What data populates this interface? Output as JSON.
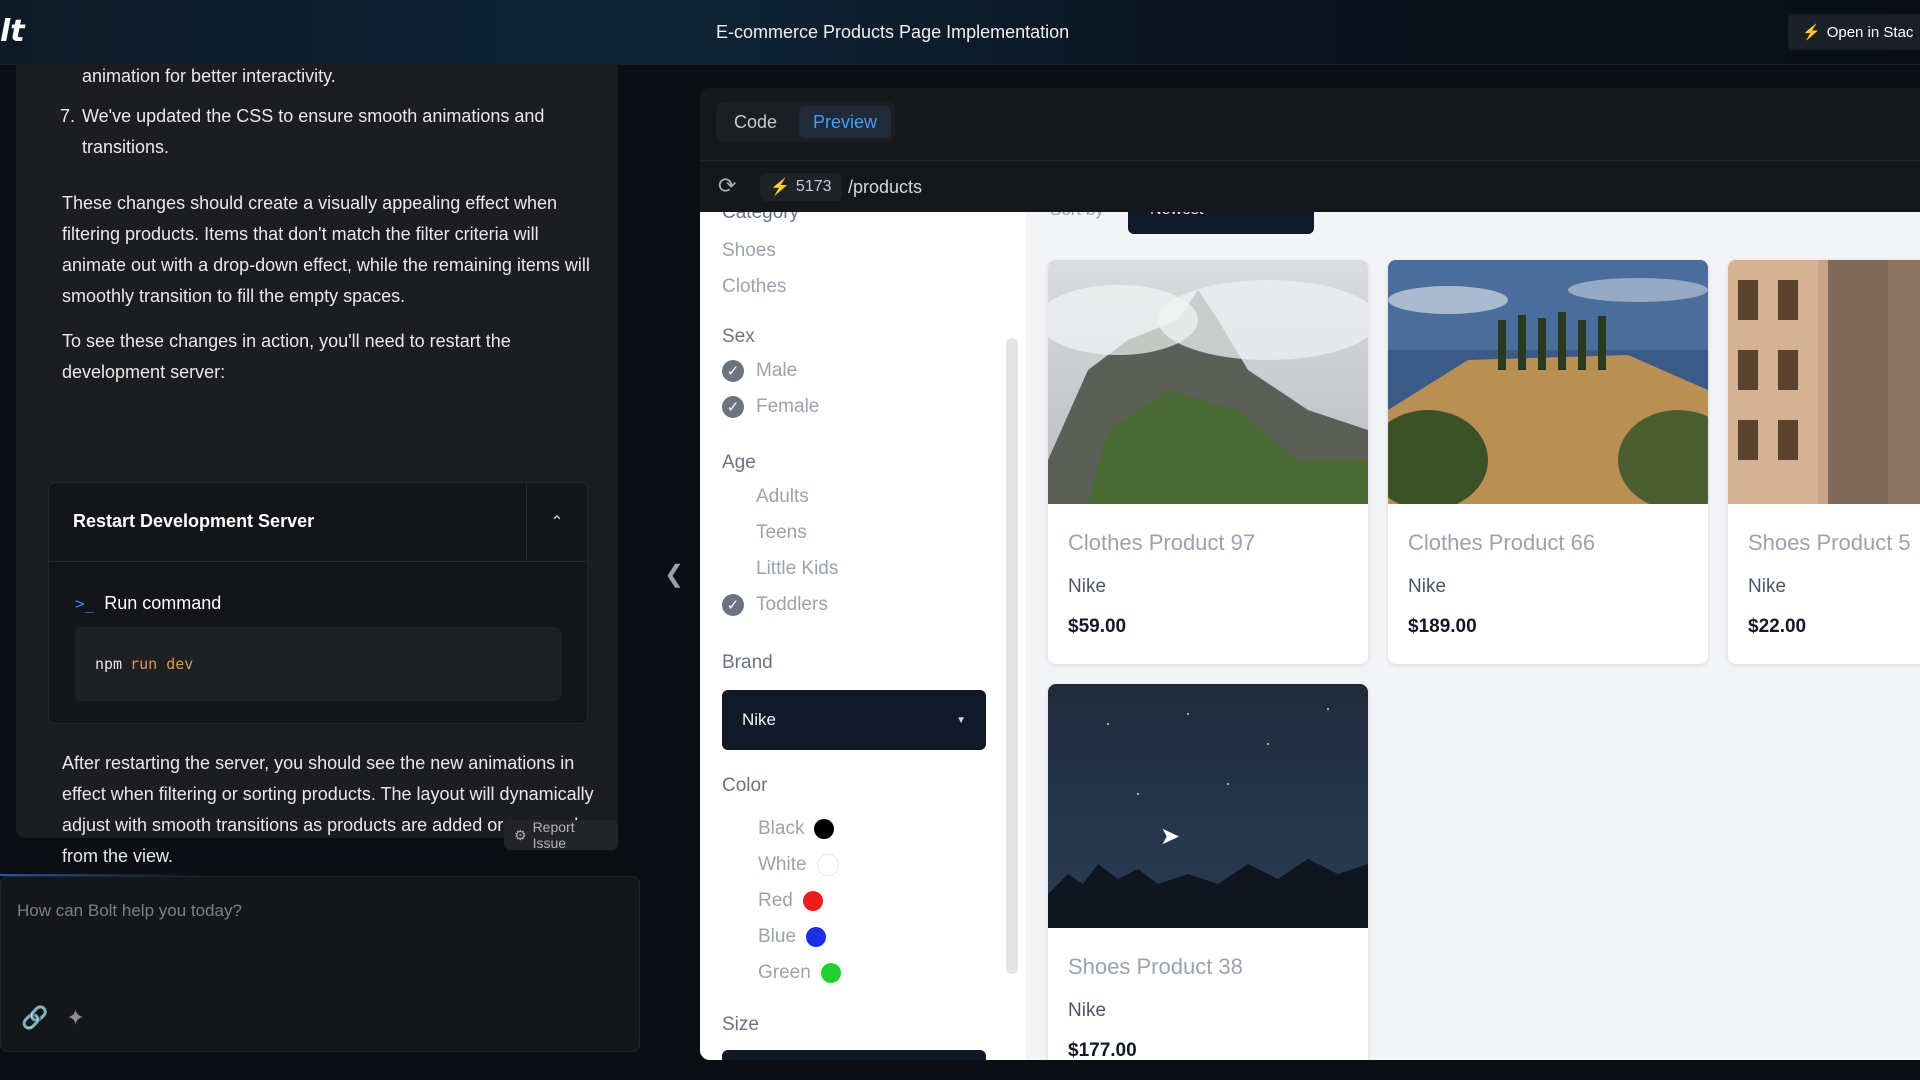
{
  "app": {
    "logo": "lt",
    "title": "E-commerce Products Page Implementation",
    "open_button": "Open in Stac"
  },
  "chat": {
    "line_top": "animation for better interactivity.",
    "item7_num": "7.",
    "item7_text": "We've updated the CSS to ensure smooth animations and transitions.",
    "para1": "These changes should create a visually appealing effect when filtering products. Items that don't match the filter criteria will animate out with a drop-down effect, while the remaining items will smoothly transition to fill the empty spaces.",
    "para2": "To see these changes in action, you'll need to restart the development server:",
    "action_title": "Restart Development Server",
    "run_label": "Run command",
    "command_kw": "npm",
    "command_args": "run dev",
    "para3": "After restarting the server, you should see the new animations in effect when filtering or sorting products. The layout will dynamically adjust with smooth transitions as products are added or removed from the view.",
    "report_label": "Report Issue",
    "input_placeholder": "How can Bolt help you today?"
  },
  "preview": {
    "tabs": [
      {
        "label": "Code"
      },
      {
        "label": "Preview"
      }
    ],
    "port": "5173",
    "path": "/products",
    "sort_label": "Sort by",
    "sort_value": "Newest",
    "filters": {
      "category_head": "Category",
      "categories": [
        "Shoes",
        "Clothes"
      ],
      "sex_head": "Sex",
      "sex": [
        {
          "label": "Male",
          "checked": true
        },
        {
          "label": "Female",
          "checked": true
        }
      ],
      "age_head": "Age",
      "age": [
        {
          "label": "Adults",
          "checked": false
        },
        {
          "label": "Teens",
          "checked": false
        },
        {
          "label": "Little Kids",
          "checked": false
        },
        {
          "label": "Toddlers",
          "checked": true
        }
      ],
      "brand_head": "Brand",
      "brand_value": "Nike",
      "color_head": "Color",
      "colors": [
        {
          "label": "Black",
          "hex": "#000000"
        },
        {
          "label": "White",
          "hex": "#ffffff"
        },
        {
          "label": "Red",
          "hex": "#ef1c1c"
        },
        {
          "label": "Blue",
          "hex": "#1c2fe6"
        },
        {
          "label": "Green",
          "hex": "#22d12f"
        }
      ],
      "size_head": "Size"
    },
    "products": [
      {
        "name": "Clothes Product 97",
        "brand": "Nike",
        "price": "$59.00"
      },
      {
        "name": "Clothes Product 66",
        "brand": "Nike",
        "price": "$189.00"
      },
      {
        "name": "Shoes Product 5",
        "brand": "Nike",
        "price": "$22.00"
      },
      {
        "name": "Shoes Product 38",
        "brand": "Nike",
        "price": "$177.00"
      }
    ]
  }
}
